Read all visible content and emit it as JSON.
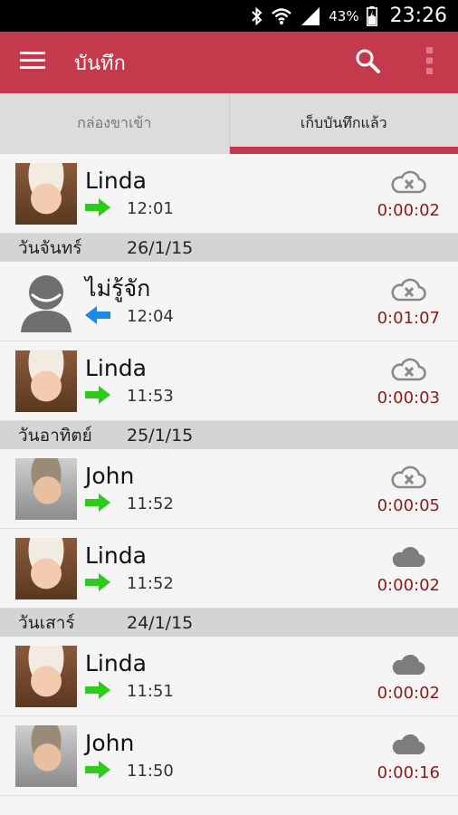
{
  "status_bar": {
    "battery_percent": "43%",
    "time": "23:26"
  },
  "app_bar": {
    "title": "บันทึก"
  },
  "tabs": [
    {
      "label": "กล่องขาเข้า",
      "active": false
    },
    {
      "label": "เก็บบันทึกแล้ว",
      "active": true
    }
  ],
  "items": [
    {
      "type": "call",
      "name": "Linda",
      "avatar": "photo-f",
      "direction": "outgoing",
      "time": "12:01",
      "duration": "0:00:02",
      "cloud": "cloud-cross-icon"
    },
    {
      "type": "section",
      "day": "วันจันทร์",
      "date": "26/1/15"
    },
    {
      "type": "call",
      "name": "ไม่รู้จัก",
      "avatar": "unknown",
      "direction": "incoming",
      "time": "12:04",
      "duration": "0:01:07",
      "cloud": "cloud-cross-icon"
    },
    {
      "type": "call",
      "name": "Linda",
      "avatar": "photo-f",
      "direction": "outgoing",
      "time": "11:53",
      "duration": "0:00:03",
      "cloud": "cloud-cross-icon"
    },
    {
      "type": "section",
      "day": "วันอาทิตย์",
      "date": "25/1/15"
    },
    {
      "type": "call",
      "name": "John",
      "avatar": "photo-m",
      "direction": "outgoing",
      "time": "11:52",
      "duration": "0:00:05",
      "cloud": "cloud-cross-icon"
    },
    {
      "type": "call",
      "name": "Linda",
      "avatar": "photo-f",
      "direction": "outgoing",
      "time": "11:52",
      "duration": "0:00:02",
      "cloud": "cloud-icon"
    },
    {
      "type": "section",
      "day": "วันเสาร์",
      "date": "24/1/15"
    },
    {
      "type": "call",
      "name": "Linda",
      "avatar": "photo-f",
      "direction": "outgoing",
      "time": "11:51",
      "duration": "0:00:02",
      "cloud": "cloud-icon"
    },
    {
      "type": "call",
      "name": "John",
      "avatar": "photo-m",
      "direction": "outgoing",
      "time": "11:50",
      "duration": "0:00:16",
      "cloud": "cloud-icon"
    }
  ],
  "colors": {
    "accent": "#c4394b",
    "outgoing_arrow": "#2ecc1a",
    "incoming_arrow": "#1e88e5",
    "duration": "#8b1a1a"
  }
}
